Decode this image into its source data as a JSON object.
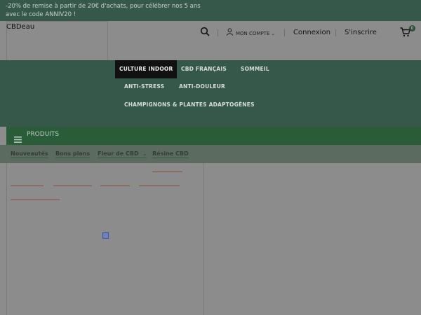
{
  "promo": {
    "line1": "-20% de remise à partir de 20€ d'achats, pour célébrer nos 5 ans",
    "line2": "avec le code ANNIV20 !"
  },
  "header": {
    "logo": "CBDeau",
    "account_label": "MON COMPTE",
    "login_label": "Connexion",
    "signup_label": "S'inscrire",
    "cart_count": "0"
  },
  "nav": {
    "items": [
      {
        "label": "CULTURE INDOOR",
        "active": true
      },
      {
        "label": "CBD FRANÇAIS",
        "active": false
      },
      {
        "label": "SOMMEIL",
        "active": false
      },
      {
        "label": "ANTI-STRESS",
        "active": false
      },
      {
        "label": "ANTI-DOULEUR",
        "active": false
      },
      {
        "label": "CHAMPIGNONS & PLANTES ADAPTOGÈNES",
        "active": false
      }
    ]
  },
  "products": {
    "label": "PRODUITS"
  },
  "subnav": {
    "items": [
      {
        "label": "Nouveautés"
      },
      {
        "label": "Bons plans"
      },
      {
        "label": "Fleur de CBD"
      },
      {
        "label": "Résine CBD"
      }
    ]
  },
  "colors": {
    "promo_bg": "#35584a",
    "nav_bg": "#35584a",
    "products_bg": "#2b5c3a",
    "overlay": "#8c8c8c"
  }
}
